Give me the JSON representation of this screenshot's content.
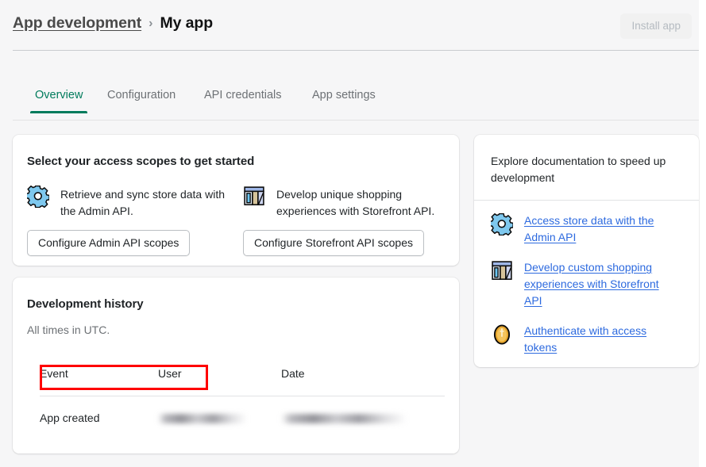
{
  "header": {
    "breadcrumb_link": "App development",
    "breadcrumb_separator": "›",
    "page_title": "My app",
    "install_button": "Install app",
    "install_button_disabled": true
  },
  "tabs": [
    {
      "label": "Overview",
      "active": true
    },
    {
      "label": "Configuration",
      "active": false
    },
    {
      "label": "API credentials",
      "active": false
    },
    {
      "label": "App settings",
      "active": false
    }
  ],
  "scopes_card": {
    "title": "Select your access scopes to get started",
    "options": [
      {
        "icon": "gear-icon",
        "description": "Retrieve and sync store data with the Admin API.",
        "button_label": "Configure Admin API scopes",
        "highlighted": true
      },
      {
        "icon": "storefront-icon",
        "description": "Develop unique shopping experiences with Storefront API.",
        "button_label": "Configure Storefront API scopes",
        "highlighted": false
      }
    ]
  },
  "history_card": {
    "title": "Development history",
    "subtitle": "All times in UTC.",
    "columns": [
      "Event",
      "User",
      "Date"
    ],
    "rows": [
      {
        "event": "App created",
        "user": "",
        "date": "",
        "user_redacted": true,
        "date_redacted": true
      }
    ]
  },
  "docs_card": {
    "heading": "Explore documentation to speed up development",
    "links": [
      {
        "icon": "gear-icon",
        "label": "Access store data with the Admin API"
      },
      {
        "icon": "storefront-icon",
        "label": "Develop custom shopping experiences with Storefront API"
      },
      {
        "icon": "token-icon",
        "label": "Authenticate with access tokens"
      }
    ]
  },
  "annotation": {
    "type": "red-highlight-box",
    "target": "Configure Admin API scopes"
  },
  "colors": {
    "page_background": "#f6f6f7",
    "card_background": "#ffffff",
    "accent_green": "#007b5c",
    "link_blue": "#2d6adf",
    "text_primary": "#1f2326",
    "text_subdued": "#6d7175",
    "annotation_red": "#ff0000"
  }
}
